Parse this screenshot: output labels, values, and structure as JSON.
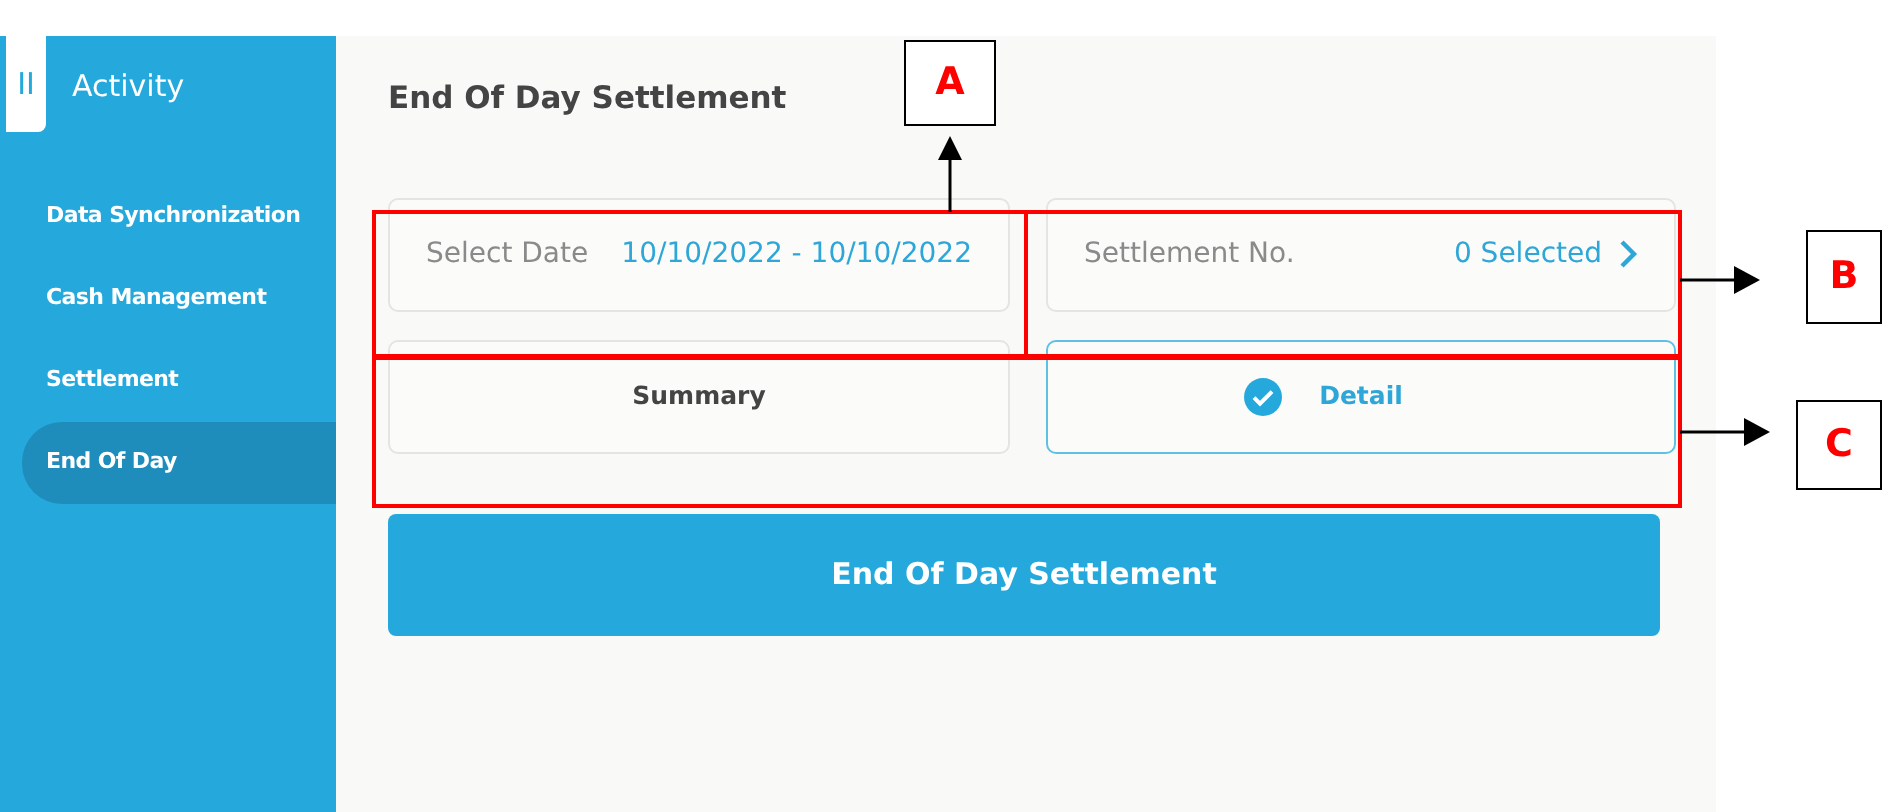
{
  "sidebar": {
    "header": {
      "icon": "II",
      "title": "Activity"
    },
    "items": [
      {
        "label": "Data Synchronization",
        "selected": false
      },
      {
        "label": "Cash Management",
        "selected": false
      },
      {
        "label": "Settlement",
        "selected": false
      },
      {
        "label": "End Of Day",
        "selected": true
      }
    ]
  },
  "page": {
    "title": "End Of Day Settlement",
    "fields": [
      {
        "label": "Select Date",
        "value": "10/10/2022 - 10/10/2022",
        "chevron": false
      },
      {
        "label": "Settlement No.",
        "value": "0 Selected",
        "chevron": true
      }
    ],
    "options": [
      {
        "label": "Summary",
        "selected": false
      },
      {
        "label": "Detail",
        "selected": true
      }
    ],
    "submit": "End Of Day Settlement"
  },
  "annotations": [
    {
      "label": "A"
    },
    {
      "label": "B"
    },
    {
      "label": "C"
    }
  ]
}
